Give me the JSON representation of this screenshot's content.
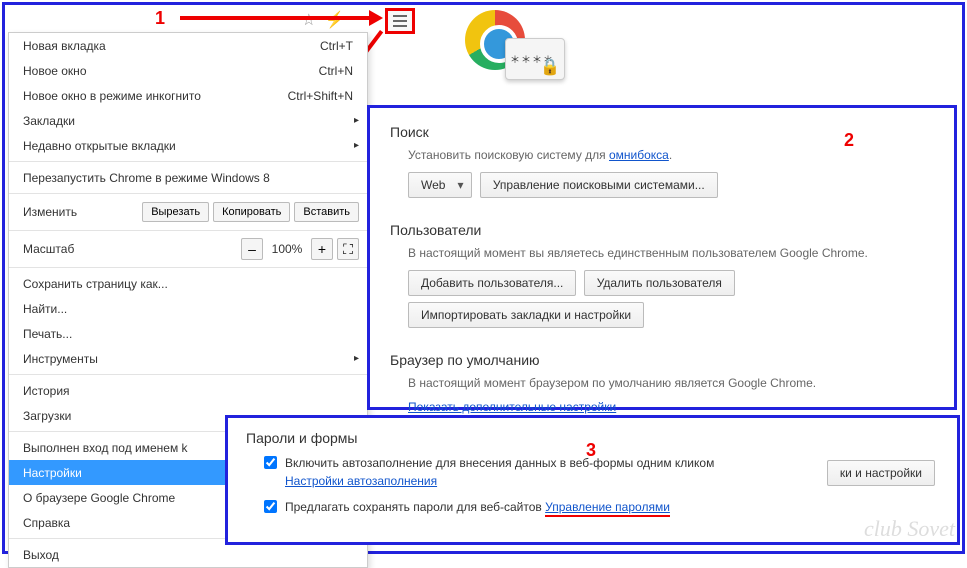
{
  "annotations": {
    "step1": "1",
    "step2": "2",
    "step3": "3"
  },
  "toolbar": {
    "star_icon": "☆",
    "bolt_icon": "⚡"
  },
  "menu": {
    "new_tab": {
      "label": "Новая вкладка",
      "shortcut": "Ctrl+T"
    },
    "new_window": {
      "label": "Новое окно",
      "shortcut": "Ctrl+N"
    },
    "incognito": {
      "label": "Новое окно в режиме инкогнито",
      "shortcut": "Ctrl+Shift+N"
    },
    "bookmarks": {
      "label": "Закладки"
    },
    "recent_tabs": {
      "label": "Недавно открытые вкладки"
    },
    "relaunch_win8": {
      "label": "Перезапустить Chrome в режиме Windows 8"
    },
    "edit": {
      "label": "Изменить",
      "cut": "Вырезать",
      "copy": "Копировать",
      "paste": "Вставить"
    },
    "zoom": {
      "label": "Масштаб",
      "minus": "–",
      "value": "100%",
      "plus": "+",
      "full": "⛶"
    },
    "save_as": {
      "label": "Сохранить страницу как..."
    },
    "find": {
      "label": "Найти..."
    },
    "print": {
      "label": "Печать..."
    },
    "tools": {
      "label": "Инструменты"
    },
    "history": {
      "label": "История"
    },
    "downloads": {
      "label": "Загрузки"
    },
    "signed_in": {
      "label": "Выполнен вход под именем k"
    },
    "settings": {
      "label": "Настройки"
    },
    "about": {
      "label": "О браузере Google Chrome"
    },
    "help": {
      "label": "Справка"
    },
    "exit": {
      "label": "Выход"
    }
  },
  "panel": {
    "search_title": "Поиск",
    "search_text": "Установить поисковую систему для ",
    "omnibox_link": "омнибокса",
    "search_engine": "Web",
    "manage_engines": "Управление поисковыми системами...",
    "users_title": "Пользователи",
    "users_text": "В настоящий момент вы являетесь единственным пользователем Google Chrome.",
    "add_user": "Добавить пользователя...",
    "delete_user": "Удалить пользователя",
    "import": "Импортировать закладки и настройки",
    "default_title": "Браузер по умолчанию",
    "default_text": "В настоящий момент браузером по умолчанию является Google Chrome.",
    "advanced_link": "Показать дополнительные настройки"
  },
  "passwords": {
    "title": "Пароли и формы",
    "autofill_label": "Включить автозаполнение для внесения данных в веб-формы одним кликом",
    "autofill_link": "Настройки автозаполнения",
    "save_pw_label": "Предлагать сохранять пароли для веб-сайтов",
    "manage_pw_link": "Управление паролями",
    "peek_btn": "ки и настройки"
  },
  "watermark": "club Sovet"
}
